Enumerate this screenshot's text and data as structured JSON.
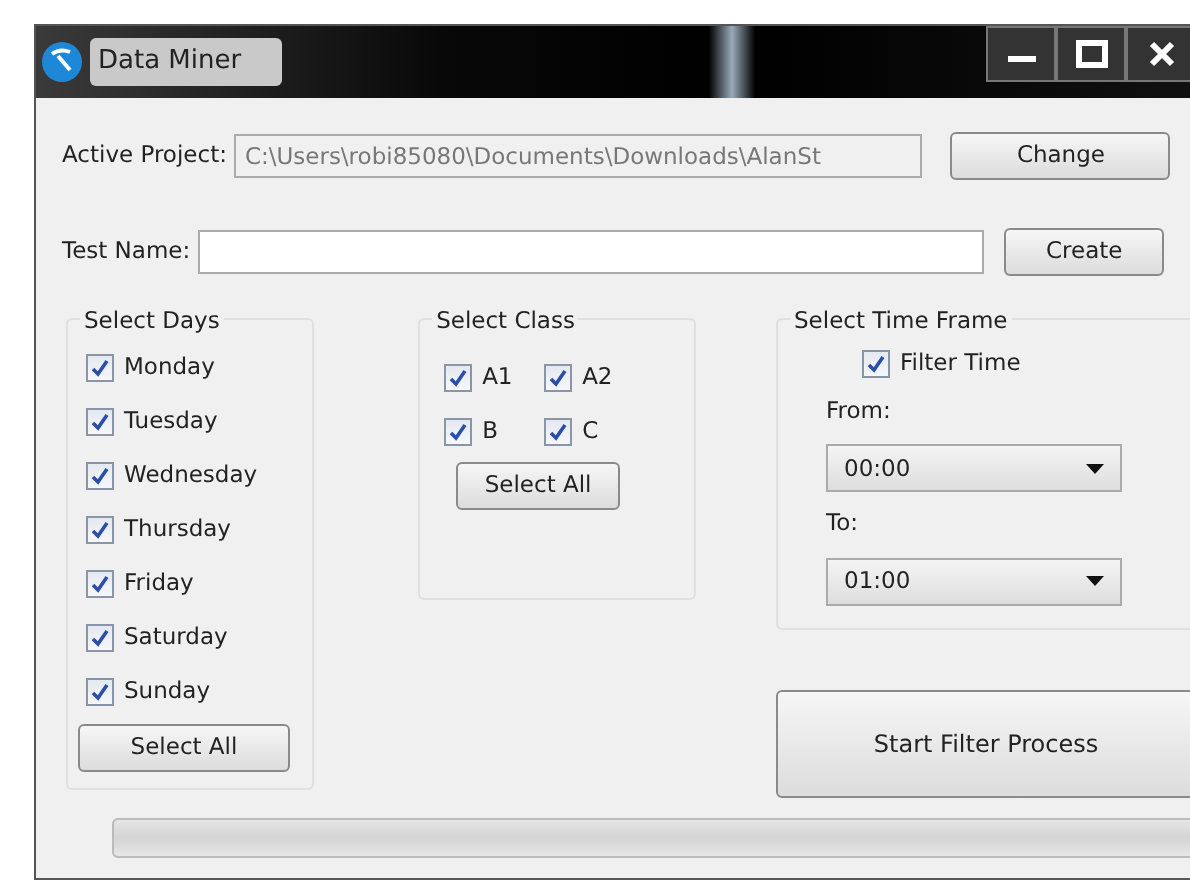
{
  "window": {
    "title": "Data Miner"
  },
  "active_project": {
    "label": "Active Project:",
    "value": "C:\\Users\\robi85080\\Documents\\Downloads\\AlanSt",
    "button": "Change"
  },
  "test_name": {
    "label": "Test Name:",
    "button": "Create"
  },
  "select_days": {
    "title": "Select Days",
    "items": [
      {
        "label": "Monday",
        "checked": true
      },
      {
        "label": "Tuesday",
        "checked": true
      },
      {
        "label": "Wednesday",
        "checked": true
      },
      {
        "label": "Thursday",
        "checked": true
      },
      {
        "label": "Friday",
        "checked": true
      },
      {
        "label": "Saturday",
        "checked": true
      },
      {
        "label": "Sunday",
        "checked": true
      }
    ],
    "button": "Select All"
  },
  "select_class": {
    "title": "Select Class",
    "items": [
      {
        "label": "A1",
        "checked": true
      },
      {
        "label": "A2",
        "checked": true
      },
      {
        "label": "B",
        "checked": true
      },
      {
        "label": "C",
        "checked": true
      }
    ],
    "button": "Select All"
  },
  "time_frame": {
    "title": "Select Time Frame",
    "filter": {
      "label": "Filter Time",
      "checked": true
    },
    "from_label": "From:",
    "from_value": "00:00",
    "to_label": "To:",
    "to_value": "01:00"
  },
  "start_button": "Start Filter Process",
  "progress": {
    "level": 0
  }
}
